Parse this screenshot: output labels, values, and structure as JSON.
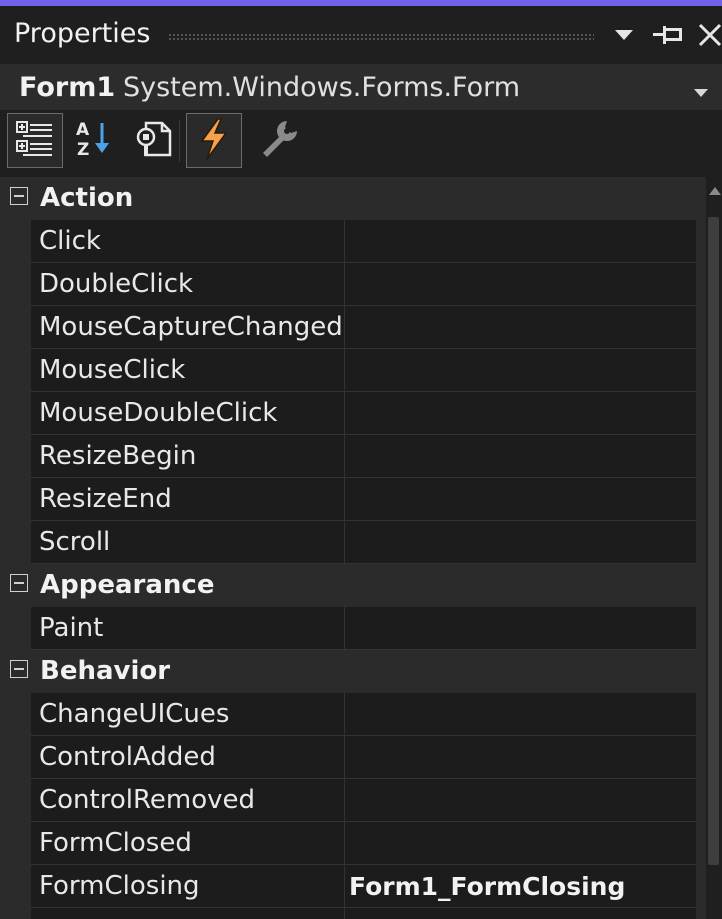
{
  "window": {
    "title": "Properties",
    "accent_color": "#7160e8"
  },
  "object_selector": {
    "name": "Form1",
    "type": "System.Windows.Forms.Form"
  },
  "toolbar": {
    "buttons": [
      {
        "icon": "categorized-icon",
        "active": true
      },
      {
        "icon": "alphabetical-icon",
        "active": false
      },
      {
        "icon": "properties-icon",
        "active": false
      },
      {
        "icon": "events-lightning-icon",
        "active": true
      },
      {
        "icon": "property-pages-wrench-icon",
        "active": false
      }
    ]
  },
  "grid": {
    "categories": [
      {
        "label": "Action",
        "items": [
          {
            "name": "Click",
            "value": ""
          },
          {
            "name": "DoubleClick",
            "value": ""
          },
          {
            "name": "MouseCaptureChanged",
            "value": ""
          },
          {
            "name": "MouseClick",
            "value": ""
          },
          {
            "name": "MouseDoubleClick",
            "value": ""
          },
          {
            "name": "ResizeBegin",
            "value": ""
          },
          {
            "name": "ResizeEnd",
            "value": ""
          },
          {
            "name": "Scroll",
            "value": ""
          }
        ]
      },
      {
        "label": "Appearance",
        "items": [
          {
            "name": "Paint",
            "value": ""
          }
        ]
      },
      {
        "label": "Behavior",
        "items": [
          {
            "name": "ChangeUICues",
            "value": ""
          },
          {
            "name": "ControlAdded",
            "value": ""
          },
          {
            "name": "ControlRemoved",
            "value": ""
          },
          {
            "name": "FormClosed",
            "value": ""
          },
          {
            "name": "FormClosing",
            "value": "Form1_FormClosing"
          }
        ]
      }
    ]
  }
}
